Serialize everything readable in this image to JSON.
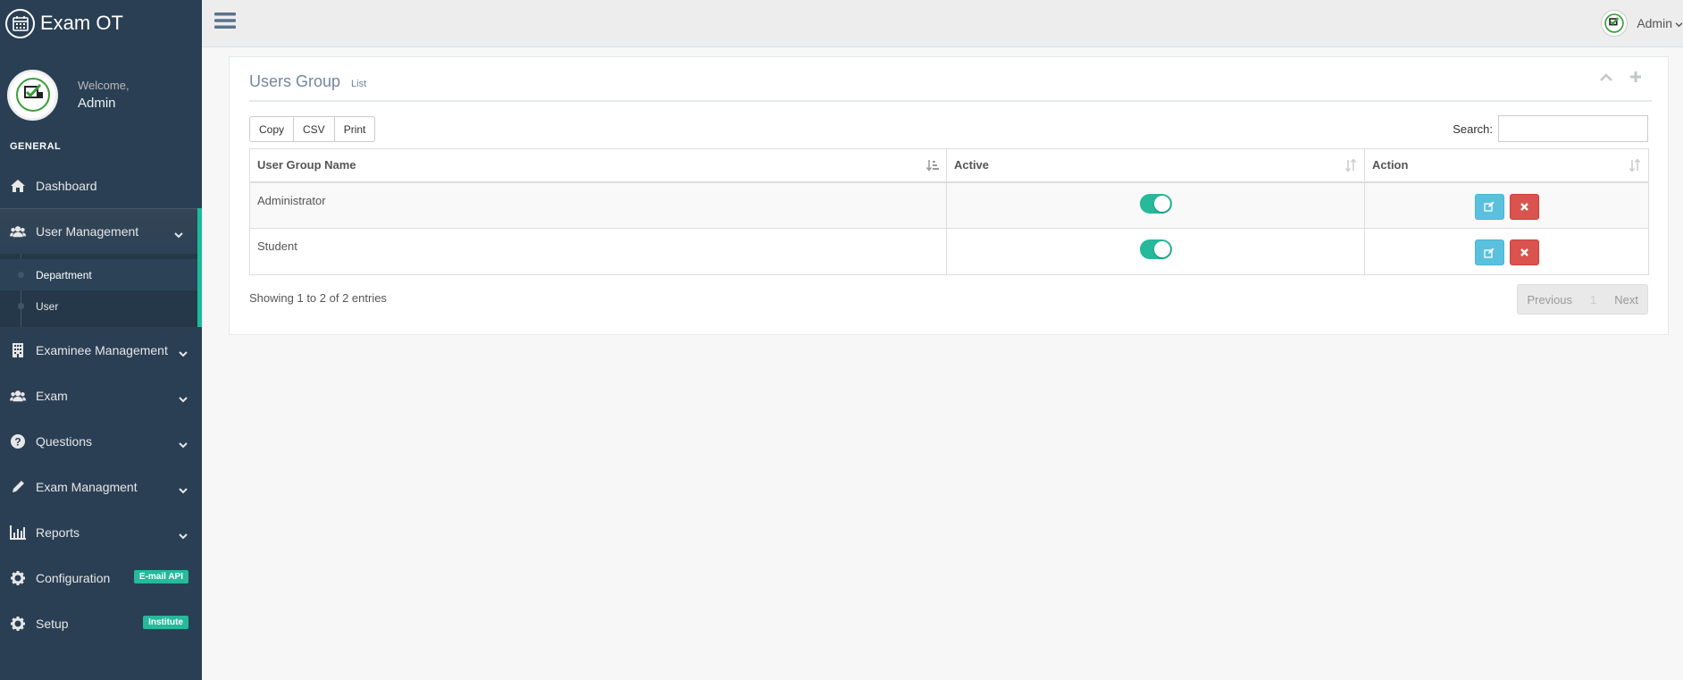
{
  "app": {
    "title": "Exam OT"
  },
  "profile": {
    "welcome": "Welcome,",
    "name": "Admin"
  },
  "sidebar": {
    "section": "GENERAL",
    "items": [
      {
        "label": "Dashboard",
        "icon": "home-icon"
      },
      {
        "label": "User Management",
        "icon": "users-icon",
        "sub": [
          "Department",
          "User"
        ]
      },
      {
        "label": "Examinee Management",
        "icon": "building-icon"
      },
      {
        "label": "Exam",
        "icon": "users-icon"
      },
      {
        "label": "Questions",
        "icon": "question-icon"
      },
      {
        "label": "Exam Managment",
        "icon": "pencil-icon"
      },
      {
        "label": "Reports",
        "icon": "bar-chart-icon"
      },
      {
        "label": "Configuration",
        "icon": "gear-icon",
        "badge": "E-mail  API"
      },
      {
        "label": "Setup",
        "icon": "gear-icon",
        "badge": "Institute"
      }
    ]
  },
  "topnav": {
    "user": "Admin"
  },
  "panel": {
    "title": "Users Group",
    "subtitle": "List",
    "buttons": [
      "Copy",
      "CSV",
      "Print"
    ],
    "search_label": "Search:",
    "columns": [
      "User Group Name",
      "Active",
      "Action"
    ],
    "rows": [
      {
        "name": "Administrator",
        "active": true
      },
      {
        "name": "Student",
        "active": true
      }
    ],
    "info": "Showing 1 to 2 of 2 entries",
    "pager": {
      "prev": "Previous",
      "page": "1",
      "next": "Next"
    }
  },
  "colors": {
    "sidebar": "#2a3f54",
    "accent": "#1abb9c",
    "toggle": "#26b99a",
    "edit": "#5bc0de",
    "delete": "#d9534f"
  }
}
